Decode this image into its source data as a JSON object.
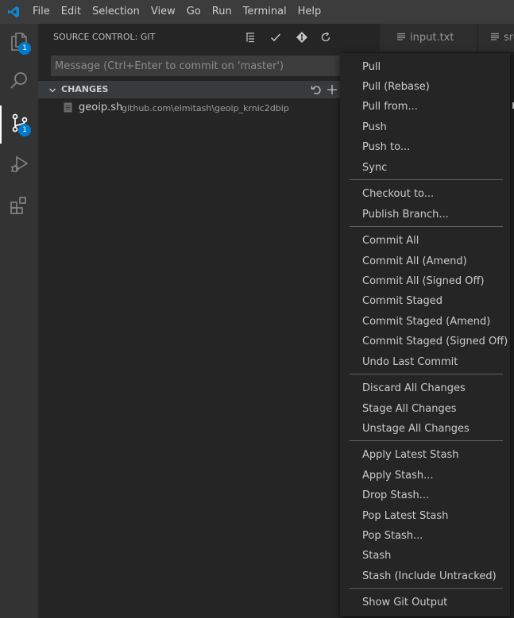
{
  "menubar": {
    "items": [
      "File",
      "Edit",
      "Selection",
      "View",
      "Go",
      "Run",
      "Terminal",
      "Help"
    ]
  },
  "activitybar": {
    "explorer_badge": "1",
    "scm_badge": "1"
  },
  "scm": {
    "title": "SOURCE CONTROL: GIT",
    "commit_placeholder": "Message (Ctrl+Enter to commit on 'master')",
    "changes_title": "CHANGES",
    "files": [
      {
        "name": "geoip.sh",
        "path": "github.com\\elmitash\\geoip_krnic2dbip"
      }
    ]
  },
  "tabs": [
    {
      "label": "input.txt"
    },
    {
      "label": "src"
    }
  ],
  "context_menu": {
    "items": [
      "Pull",
      "Pull (Rebase)",
      "Pull from...",
      "Push",
      "Push to...",
      "Sync",
      "Checkout to...",
      "Publish Branch...",
      "Commit All",
      "Commit All (Amend)",
      "Commit All (Signed Off)",
      "Commit Staged",
      "Commit Staged (Amend)",
      "Commit Staged (Signed Off)",
      "Undo Last Commit",
      "Discard All Changes",
      "Stage All Changes",
      "Unstage All Changes",
      "Apply Latest Stash",
      "Apply Stash...",
      "Drop Stash...",
      "Pop Latest Stash",
      "Pop Stash...",
      "Stash",
      "Stash (Include Untracked)",
      "Show Git Output"
    ]
  }
}
